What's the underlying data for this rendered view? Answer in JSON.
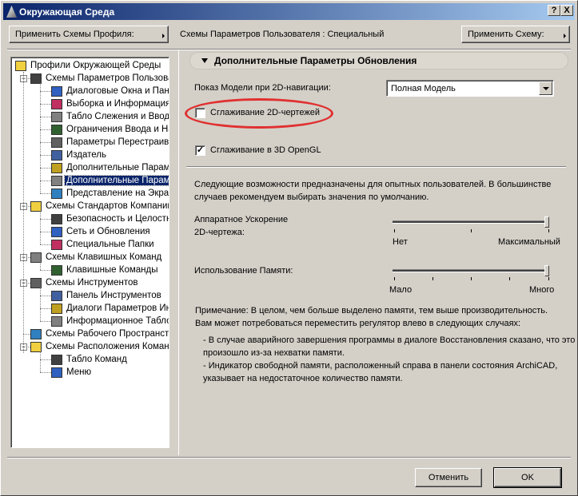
{
  "window": {
    "title": "Окружающая Среда",
    "help": "?",
    "close": "X"
  },
  "toolbar": {
    "apply_profile": "Применить Схемы Профиля:",
    "current_scheme": "Схемы Параметров Пользователя : Специальный",
    "apply_scheme": "Применить Схему:"
  },
  "tree": [
    {
      "label": "Профили Окружающей Среды",
      "level": 0
    },
    {
      "label": "Схемы Параметров Пользоват",
      "level": 1,
      "expanded": true
    },
    {
      "label": "Диалоговые Окна и Панел",
      "level": 2
    },
    {
      "label": "Выборка и Информация об",
      "level": 2
    },
    {
      "label": "Табло Слежения и Ввод Ко",
      "level": 2
    },
    {
      "label": "Ограничения Ввода и Напр",
      "level": 2
    },
    {
      "label": "Параметры Перестраивани",
      "level": 2
    },
    {
      "label": "Издатель",
      "level": 2
    },
    {
      "label": "Дополнительные Параметр",
      "level": 2
    },
    {
      "label": "Дополнительные Параметр",
      "level": 2,
      "selected": true
    },
    {
      "label": "Представление на Экране",
      "level": 2
    },
    {
      "label": "Схемы Стандартов Компании",
      "level": 1,
      "expanded": true
    },
    {
      "label": "Безопасность и Целостнос",
      "level": 2
    },
    {
      "label": "Сеть и Обновления",
      "level": 2
    },
    {
      "label": "Специальные Папки",
      "level": 2
    },
    {
      "label": "Схемы Клавишных Команд",
      "level": 1,
      "expanded": true
    },
    {
      "label": "Клавишные Команды",
      "level": 2
    },
    {
      "label": "Схемы Инструментов",
      "level": 1,
      "expanded": true
    },
    {
      "label": "Панель Инструментов",
      "level": 2
    },
    {
      "label": "Диалоги Параметров Инстр",
      "level": 2
    },
    {
      "label": "Информационное Табло",
      "level": 2
    },
    {
      "label": "Схемы Рабочего Пространства",
      "level": 1
    },
    {
      "label": "Схемы Расположения Команд",
      "level": 1,
      "expanded": true
    },
    {
      "label": "Табло Команд",
      "level": 2
    },
    {
      "label": "Меню",
      "level": 2
    }
  ],
  "section": {
    "title": "Дополнительные Параметры Обновления"
  },
  "model_display": {
    "label": "Показ Модели при 2D-навигации:",
    "value": "Полная Модель"
  },
  "smoothing_2d": {
    "label": "Сглаживание 2D-чертежей",
    "checked": false
  },
  "smoothing_3d": {
    "label": "Сглаживание в 3D OpenGL",
    "checked": true,
    "mark": "✓"
  },
  "advanced_note": "Следующие возможности предназначены для опытных пользователей. В большинстве случаев рекомендуем выбирать значения по умолчанию.",
  "hw_accel": {
    "label_line1": "Аппаратное Ускорение",
    "label_line2": "2D-чертежа:",
    "min": "Нет",
    "max": "Максимальный",
    "value_percent": 100
  },
  "memory": {
    "label": "Использование Памяти:",
    "min": "Мало",
    "max": "Много",
    "value_percent": 100
  },
  "note": {
    "line1": "Примечание: В целом, чем больше выделено памяти, тем выше производительность.",
    "line2": "Вам может потребоваться переместить регулятор влево в следующих случаях:",
    "bullet1_a": "- В случае аварийного завершения программы в диалоге Восстановления сказано, что это",
    "bullet1_b": "произошло из-за нехватки памяти.",
    "bullet2_a": "- Индикатор свободной памяти, расположенный справа в панели состояния ArchiCAD,",
    "bullet2_b": "указывает на недостаточное количество памяти."
  },
  "buttons": {
    "cancel": "Отменить",
    "ok": "OK"
  },
  "colors": {
    "titlebar": "#0a246a",
    "highlight": "#0a246a",
    "annotation": "#e03030"
  }
}
